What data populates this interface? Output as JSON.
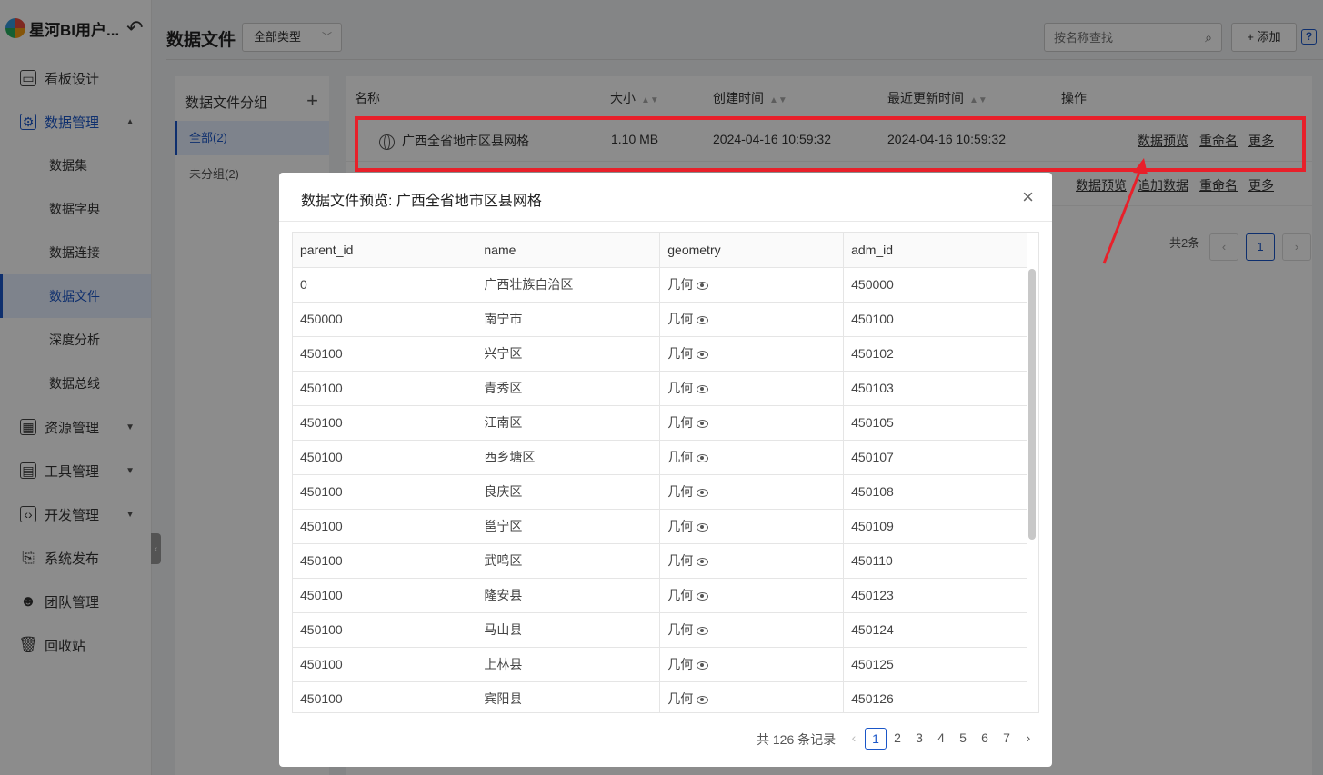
{
  "app": {
    "name": "星河BI用户...",
    "back_icon": "undo-arrow-icon"
  },
  "sidebar": {
    "items": [
      {
        "label": "看板设计",
        "icon": "dashboard-icon"
      },
      {
        "label": "数据管理",
        "icon": "data-manage-icon",
        "expanded": true
      },
      {
        "label": "资源管理",
        "icon": "resource-icon"
      },
      {
        "label": "工具管理",
        "icon": "toolbox-icon"
      },
      {
        "label": "开发管理",
        "icon": "code-icon"
      },
      {
        "label": "系统发布",
        "icon": "publish-icon"
      },
      {
        "label": "团队管理",
        "icon": "team-icon"
      },
      {
        "label": "回收站",
        "icon": "trash-icon"
      }
    ],
    "sub_items": [
      "数据集",
      "数据字典",
      "数据连接",
      "数据文件",
      "深度分析",
      "数据总线"
    ],
    "active_sub": "数据文件"
  },
  "header": {
    "title": "数据文件",
    "type_select": "全部类型",
    "search_placeholder": "按名称查找",
    "add_label": "+ 添加",
    "help": "?"
  },
  "groups": {
    "title": "数据文件分组",
    "add": "+",
    "items": [
      "全部(2)",
      "未分组(2)"
    ]
  },
  "file_table": {
    "columns": [
      "名称",
      "大小",
      "创建时间",
      "最近更新时间",
      "操作"
    ],
    "rows": [
      {
        "name": "广西全省地市区县网格",
        "size": "1.10 MB",
        "created": "2024-04-16 10:59:32",
        "updated": "2024-04-16 10:59:32",
        "actions": [
          "数据预览",
          "重命名",
          "更多"
        ]
      }
    ],
    "row2_actions": [
      "数据预览",
      "追加数据",
      "重命名",
      "更多"
    ],
    "total": "共2条",
    "page": "1"
  },
  "modal": {
    "title": "数据文件预览: 广西全省地市区县网格",
    "columns": [
      "parent_id",
      "name",
      "geometry",
      "adm_id"
    ],
    "rows": [
      [
        "0",
        "广西壮族自治区",
        "几何",
        "450000"
      ],
      [
        "450000",
        "南宁市",
        "几何",
        "450100"
      ],
      [
        "450100",
        "兴宁区",
        "几何",
        "450102"
      ],
      [
        "450100",
        "青秀区",
        "几何",
        "450103"
      ],
      [
        "450100",
        "江南区",
        "几何",
        "450105"
      ],
      [
        "450100",
        "西乡塘区",
        "几何",
        "450107"
      ],
      [
        "450100",
        "良庆区",
        "几何",
        "450108"
      ],
      [
        "450100",
        "邕宁区",
        "几何",
        "450109"
      ],
      [
        "450100",
        "武鸣区",
        "几何",
        "450110"
      ],
      [
        "450100",
        "隆安县",
        "几何",
        "450123"
      ],
      [
        "450100",
        "马山县",
        "几何",
        "450124"
      ],
      [
        "450100",
        "上林县",
        "几何",
        "450125"
      ],
      [
        "450100",
        "宾阳县",
        "几何",
        "450126"
      ]
    ],
    "total": "共 126 条记录",
    "pages": [
      "1",
      "2",
      "3",
      "4",
      "5",
      "6",
      "7"
    ],
    "current_page": "1"
  },
  "colors": {
    "accent": "#1a56c8",
    "highlight": "#e8202a"
  }
}
